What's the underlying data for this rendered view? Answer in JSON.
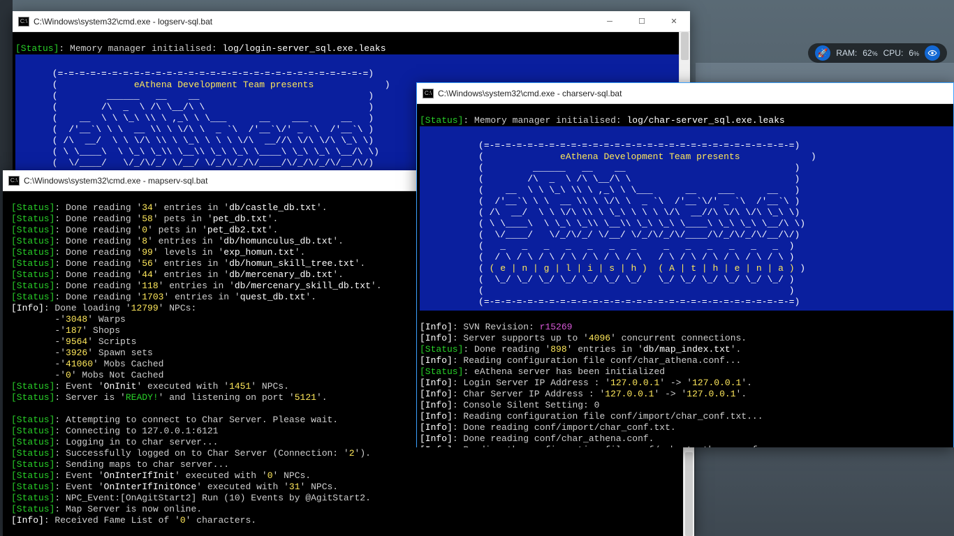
{
  "overlay": {
    "ram_label": "RAM:",
    "ram_val": "62",
    "pct": "%",
    "cpu_label": "CPU:",
    "cpu_val": "6"
  },
  "windows": {
    "login": {
      "title": "C:\\Windows\\system32\\cmd.exe - logserv-sql.bat"
    },
    "char": {
      "title": "C:\\Windows\\system32\\cmd.exe - charserv-sql.bat"
    },
    "map": {
      "title": "C:\\Windows\\system32\\cmd.exe - mapserv-sql.bat"
    }
  },
  "banner_presents": "eAthena Development Team presents",
  "banner_eng_ath": "( e | n | g | l | i | s | h )  ( A | t | h | e | n | a )",
  "login_status": "[Status]: Memory manager initialised: log/login-server_sql.exe.leaks",
  "char_status": "[Status]: Memory manager initialised: log/char-server_sql.exe.leaks",
  "char_lines": {
    "svn": "SVN Revision: ",
    "svn_rev": "r15269",
    "srv": "Server supports up to '",
    "srv_n": "4096",
    "srv2": "' concurrent connections.",
    "map_idx": "Done reading '",
    "map_idx_n": "898",
    "map_idx2": "' entries in '",
    "map_idx_f": "db/map_index.txt",
    "cfg1": "Reading configuration file conf/char_athena.conf...",
    "init": "eAthena server has been initialized",
    "lip": "Login Server IP Address : '",
    "ip": "127.0.0.1",
    "arrow": "' -> '",
    "tail": "'.",
    "cip": "Char Server IP Address : '",
    "cons": "Console Silent Setting: 0",
    "cfg2": "Reading configuration file conf/import/char_conf.txt...",
    "done_imp": "Done reading conf/import/char_conf.txt.",
    "done_char": "Done reading conf/char_athena.conf.",
    "subnet": "Reading the configuration file conf/subnet_athena.conf..."
  },
  "map_lines": {
    "l1_a": "Done reading '",
    "l1_n": "34",
    "l1_b": "' entries in '",
    "l1_f": "db/castle_db.txt",
    "l1_c": "'.",
    "l2_a": "Done reading '",
    "l2_n": "58",
    "l2_b": "' pets in '",
    "l2_f": "pet_db.txt",
    "l2_c": "'.",
    "l3_a": "Done reading '",
    "l3_n": "0",
    "l3_b": "' pets in '",
    "l3_f": "pet_db2.txt",
    "l3_c": "'.",
    "l4_a": "Done reading '",
    "l4_n": "8",
    "l4_b": "' entries in '",
    "l4_f": "db/homunculus_db.txt",
    "l4_c": "'.",
    "l5_a": "Done reading '",
    "l5_n": "99",
    "l5_b": "' levels in '",
    "l5_f": "exp_homun.txt",
    "l5_c": "'.",
    "l6_a": "Done reading '",
    "l6_n": "56",
    "l6_b": "' entries in '",
    "l6_f": "db/homun_skill_tree.txt",
    "l6_c": "'.",
    "l7_a": "Done reading '",
    "l7_n": "44",
    "l7_b": "' entries in '",
    "l7_f": "db/mercenary_db.txt",
    "l7_c": "'.",
    "l8_a": "Done reading '",
    "l8_n": "118",
    "l8_b": "' entries in '",
    "l8_f": "db/mercenary_skill_db.txt",
    "l8_c": "'.",
    "l9_a": "Done reading '",
    "l9_n": "1703",
    "l9_b": "' entries in '",
    "l9_f": "quest_db.txt",
    "l9_c": "'.",
    "npc_a": "Done loading '",
    "npc_n": "12799",
    "npc_b": "' NPCs:",
    "w_n": "3048",
    "w_t": "' Warps",
    "sh_n": "187",
    "sh_t": "' Shops",
    "sc_n": "9564",
    "sc_t": "' Scripts",
    "sp_n": "3926",
    "sp_t": "' Spawn sets",
    "mc_n": "41060",
    "mc_t": "' Mobs Cached",
    "mn_n": "0",
    "mn_t": "' Mobs Not Cached",
    "oninit_a": "Event '",
    "oninit_w": "OnInit",
    "oninit_b": "' executed with '",
    "oninit_n": "1451",
    "oninit_c": "' NPCs.",
    "ready_a": "Server is '",
    "ready_w": "READY!",
    "ready_b": "' and listening on port '",
    "ready_n": "5121",
    "ready_c": "'.",
    "att": "Attempting to connect to Char Server. Please wait.",
    "conn": "Connecting to 127.0.0.1:6121",
    "logi": "Logging in to char server...",
    "succ_a": "Successfully logged on to Char Server (Connection: '",
    "succ_n": "2",
    "succ_b": "').",
    "send": "Sending maps to char server...",
    "oii_a": "Event '",
    "oii_w": "OnInterIfInit",
    "oii_b": "' executed with '",
    "oii_n": "0",
    "oii_c": "' NPCs.",
    "oiio_a": "Event '",
    "oiio_w": "OnInterIfInitOnce",
    "oiio_b": "' executed with '",
    "oiio_n": "31",
    "oiio_c": "' NPCs.",
    "agit": "NPC_Event:[OnAgitStart2] Run (10) Events by @AgitStart2.",
    "online": "Map Server is now online.",
    "fame_a": "Received Fame List of '",
    "fame_n": "0",
    "fame_b": "' characters."
  },
  "labels": {
    "Status": "[Status]",
    "Info": "[Info]",
    "colon": ": "
  }
}
